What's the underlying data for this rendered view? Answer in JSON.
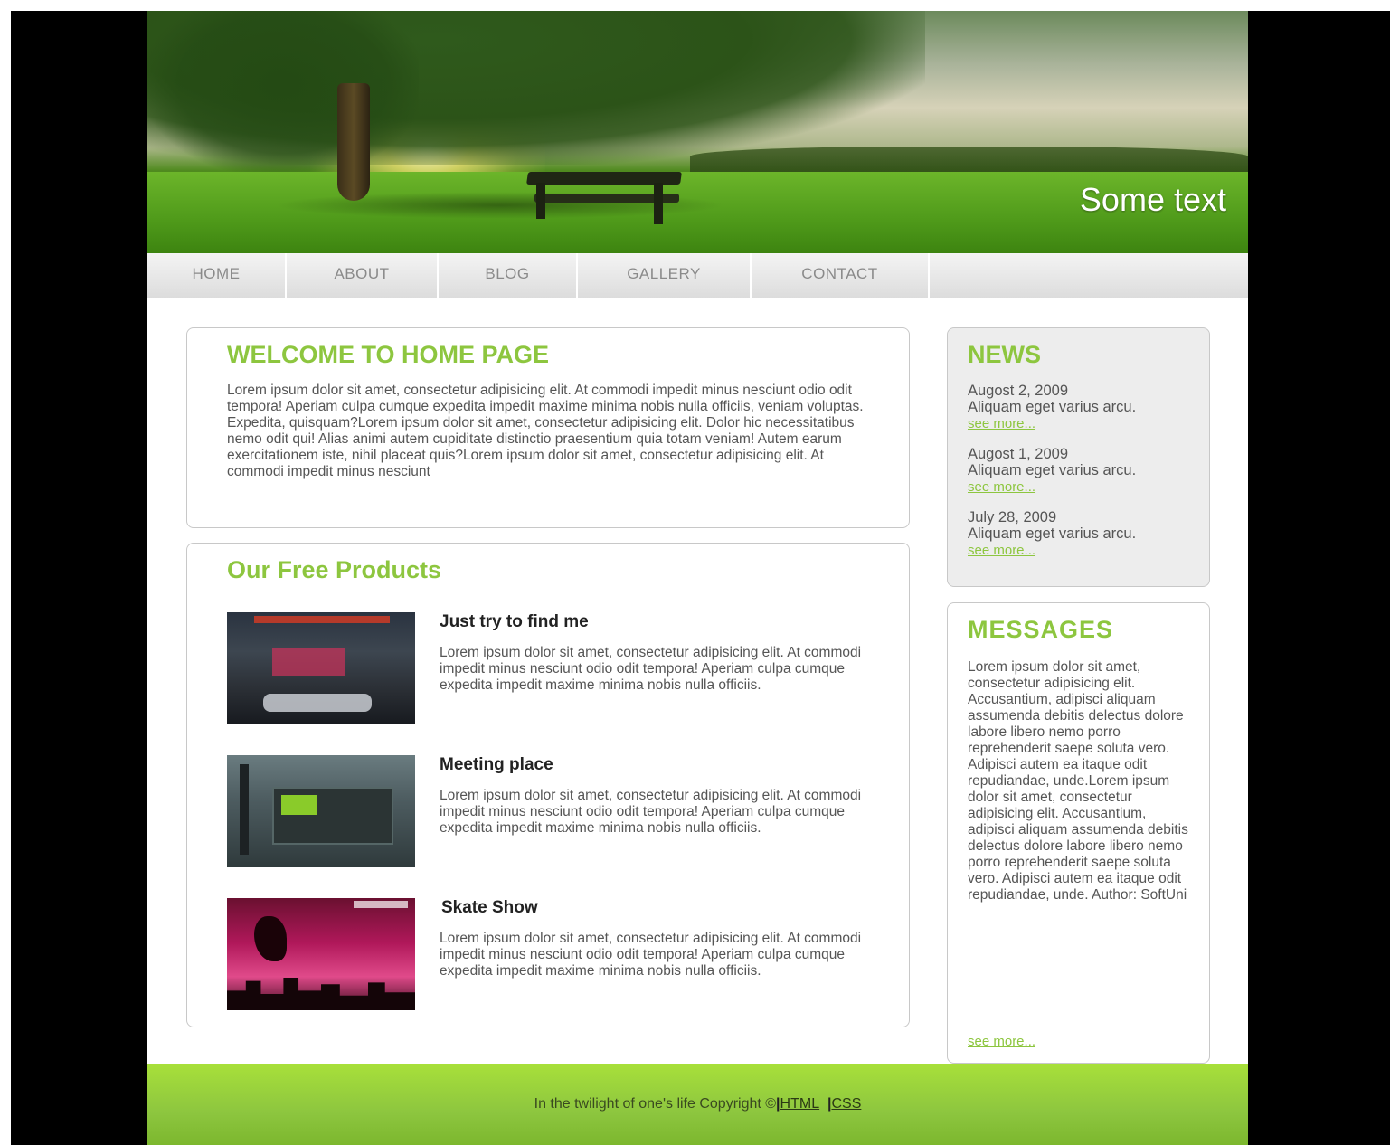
{
  "header": {
    "text": "Some text"
  },
  "nav": {
    "items": [
      {
        "label": "HOME"
      },
      {
        "label": "ABOUT"
      },
      {
        "label": "BLOG"
      },
      {
        "label": "GALLERY"
      },
      {
        "label": "CONTACT"
      }
    ]
  },
  "welcome": {
    "title": "WELCOME TO HOME PAGE",
    "body": "Lorem ipsum dolor sit amet, consectetur adipisicing elit. At commodi impedit minus nesciunt odio odit tempora! Aperiam culpa cumque expedita impedit maxime minima nobis nulla officiis, veniam voluptas. Expedita, quisquam?Lorem ipsum dolor sit amet, consectetur adipisicing elit. Dolor hic necessitatibus nemo odit qui! Alias animi autem cupiditate distinctio praesentium quia totam veniam! Autem earum exercitationem iste, nihil placeat quis?Lorem ipsum dolor sit amet, consectetur adipisicing elit. At commodi impedit minus nesciunt"
  },
  "products": {
    "title": "Our Free Products",
    "items": [
      {
        "title": "Just try to find me",
        "text": "Lorem ipsum dolor sit amet, consectetur adipisicing elit. At commodi impedit minus nesciunt odio odit tempora! Aperiam culpa cumque expedita impedit maxime minima nobis nulla officiis."
      },
      {
        "title": "Meeting place",
        "text": "Lorem ipsum dolor sit amet, consectetur adipisicing elit. At commodi impedit minus nesciunt odio odit tempora! Aperiam culpa cumque expedita impedit maxime minima nobis nulla officiis."
      },
      {
        "title": "Skate Show",
        "text": "Lorem ipsum dolor sit amet, consectetur adipisicing elit. At commodi impedit minus nesciunt odio odit tempora! Aperiam culpa cumque expedita impedit maxime minima nobis nulla officiis."
      }
    ]
  },
  "news": {
    "title": "NEWS",
    "items": [
      {
        "date": "Augost 2, 2009",
        "text": "Aliquam eget varius arcu.",
        "link": "see more..."
      },
      {
        "date": "Augost 1, 2009",
        "text": "Aliquam eget varius arcu.",
        "link": "see more..."
      },
      {
        "date": "July 28, 2009",
        "text": "Aliquam eget varius arcu.",
        "link": "see more..."
      }
    ]
  },
  "messages": {
    "title": "MESSAGES",
    "body": "Lorem ipsum dolor sit amet, consectetur adipisicing elit. Accusantium, adipisci aliquam assumenda debitis delectus dolore labore libero nemo porro reprehenderit saepe soluta vero. Adipisci autem ea itaque odit repudiandae, unde.Lorem ipsum dolor sit amet, consectetur adipisicing elit. Accusantium, adipisci aliquam assumenda debitis delectus dolore labore libero nemo porro reprehenderit saepe soluta vero. Adipisci autem ea itaque odit repudiandae, unde. Author: SoftUni",
    "link": "see more..."
  },
  "footer": {
    "text": "In the twilight of one's life Copyright ©",
    "sep": "|",
    "link_html": "HTML",
    "link_css": "CSS"
  },
  "colors": {
    "accent": "#8dc63f",
    "footer": "#8dc63f",
    "background": "#000000"
  }
}
